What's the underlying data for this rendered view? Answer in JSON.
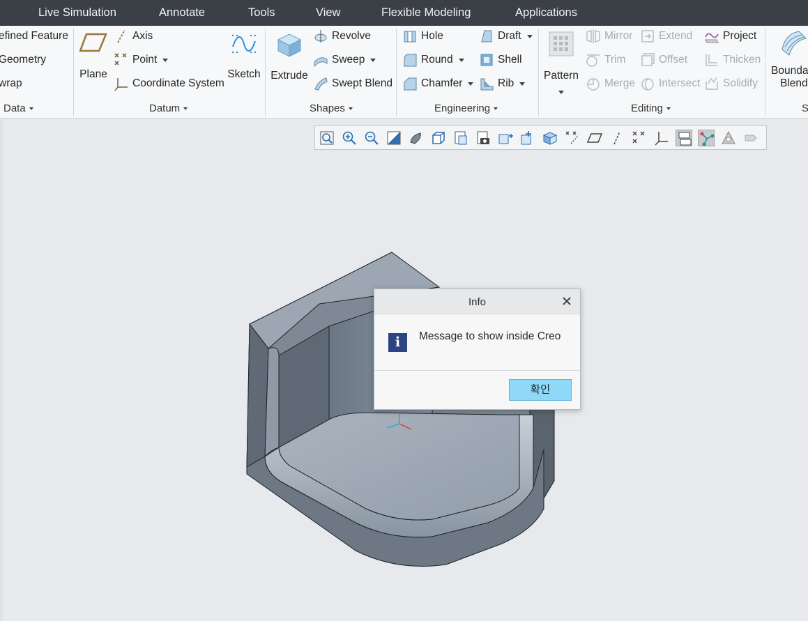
{
  "menubar": {
    "items": [
      "Live Simulation",
      "Annotate",
      "Tools",
      "View",
      "Flexible Modeling",
      "Applications"
    ]
  },
  "ribbon": {
    "data_group": {
      "items": [
        "efined Feature",
        "Geometry",
        "wrap"
      ],
      "label": "Data"
    },
    "datum_group": {
      "plane": "Plane",
      "axis": "Axis",
      "point": "Point",
      "coordinate_system": "Coordinate System",
      "sketch": "Sketch",
      "label": "Datum"
    },
    "shapes_group": {
      "extrude": "Extrude",
      "revolve": "Revolve",
      "sweep": "Sweep",
      "swept_blend": "Swept Blend",
      "label": "Shapes"
    },
    "engineering_group": {
      "hole": "Hole",
      "draft": "Draft",
      "round": "Round",
      "shell": "Shell",
      "chamfer": "Chamfer",
      "rib": "Rib",
      "label": "Engineering"
    },
    "editing_group": {
      "pattern": "Pattern",
      "mirror": "Mirror",
      "extend": "Extend",
      "project": "Project",
      "trim": "Trim",
      "offset": "Offset",
      "thicken": "Thicken",
      "merge": "Merge",
      "intersect": "Intersect",
      "solidify": "Solidify",
      "label": "Editing"
    },
    "surfaces_group": {
      "boundary_blend_line1": "Bounda",
      "boundary_blend_line2": "Blend",
      "label": "S"
    }
  },
  "graphics_toolbar": {
    "icons": [
      "refit-icon",
      "zoom-in-icon",
      "zoom-out-icon",
      "repaint-icon",
      "display-style-icon",
      "saved-orientations-icon",
      "view-manager-icon",
      "perspective-icon",
      "annotation-display-icon",
      "spin-center-icon",
      "section-icon",
      "plane-display-icon",
      "axis-display-icon",
      "point-display-icon",
      "csys-display-icon",
      "active-display-icon",
      "node-display-icon",
      "appearance-icon",
      "shade-icon"
    ]
  },
  "dialog": {
    "title": "Info",
    "message": "Message to show inside Creo",
    "ok_label": "확인"
  },
  "colors": {
    "menubar_bg": "#3a4045",
    "ribbon_bg": "#f7f8f9",
    "canvas_bg": "#e7e9ec",
    "ok_button": "#8fd8f8",
    "info_icon": "#2b4482"
  }
}
